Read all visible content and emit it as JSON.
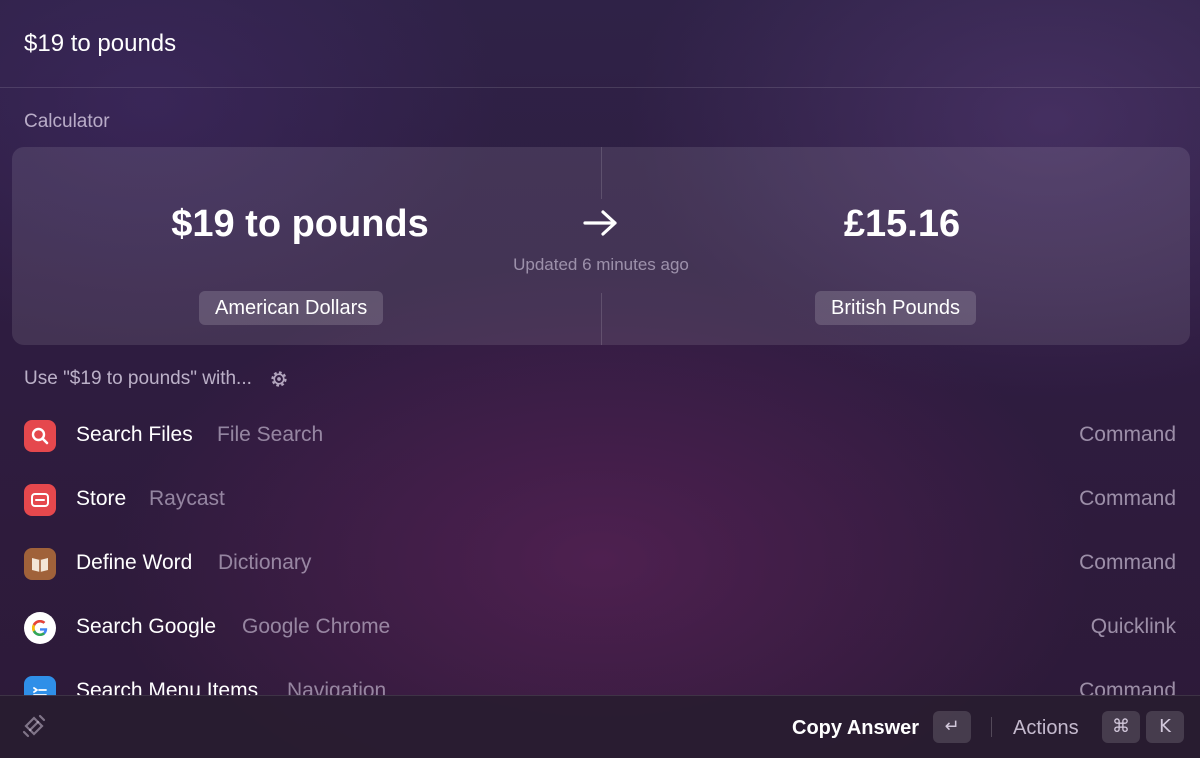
{
  "search": {
    "query": "$19 to pounds"
  },
  "calculator": {
    "section_title": "Calculator",
    "query_text": "$19 to pounds",
    "result_text": "£15.16",
    "updated_text": "Updated 6 minutes ago",
    "from_unit": "American Dollars",
    "to_unit": "British Pounds",
    "arrow_icon": "arrow-right-icon"
  },
  "use_with": {
    "label": "Use \"$19 to pounds\" with...",
    "icon": "gear-icon"
  },
  "results": [
    {
      "title": "Search Files",
      "subtitle": "File Search",
      "type": "Command",
      "icon": "search-files-icon",
      "icon_color": "#e5484d"
    },
    {
      "title": "Store",
      "subtitle": "Raycast",
      "type": "Command",
      "icon": "store-icon",
      "icon_color": "#e5484d"
    },
    {
      "title": "Define Word",
      "subtitle": "Dictionary",
      "type": "Command",
      "icon": "dictionary-icon",
      "icon_color": "#a0623a"
    },
    {
      "title": "Search Google",
      "subtitle": "Google Chrome",
      "type": "Quicklink",
      "icon": "google-icon",
      "icon_color": "#ffffff"
    },
    {
      "title": "Search Menu Items",
      "subtitle": "Navigation",
      "type": "Command",
      "icon": "menu-items-icon",
      "icon_color": "#2f8fe8"
    }
  ],
  "footer": {
    "logo_icon": "raycast-logo-icon",
    "primary_action": "Copy Answer",
    "primary_key": "↵",
    "actions_label": "Actions",
    "actions_keys": [
      "⌘",
      "K"
    ]
  }
}
